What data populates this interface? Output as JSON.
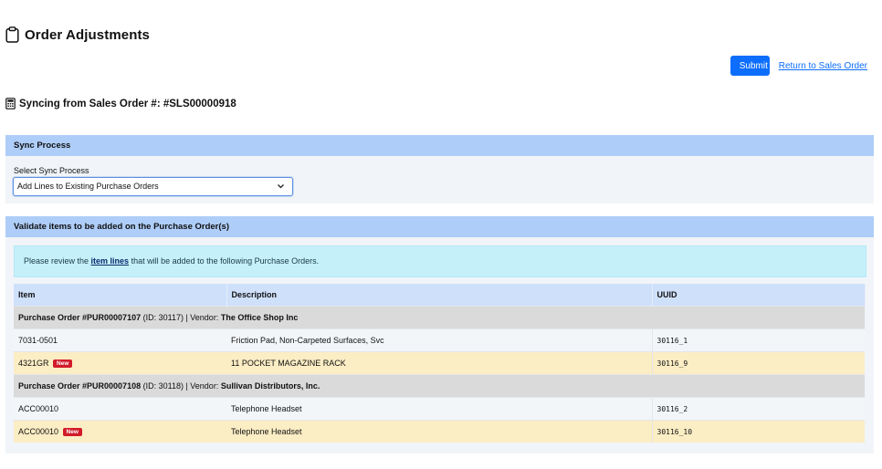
{
  "header": {
    "title": "Order Adjustments",
    "title_icon": "clipboard-icon"
  },
  "actions": {
    "submit_label": "Submit",
    "return_label": "Return to Sales Order"
  },
  "sync_heading": {
    "icon": "calculator-icon",
    "text": "Syncing from Sales Order #: #SLS00000918"
  },
  "sync_panel": {
    "header": "Sync Process",
    "select_label": "Select Sync Process",
    "select_value": "Add Lines to Existing Purchase Orders"
  },
  "validate_panel": {
    "header": "Validate items to be added on the Purchase Order(s)",
    "info_prefix": "Please review the ",
    "info_link": "item lines",
    "info_suffix": " that will be added to the following Purchase Orders."
  },
  "table": {
    "columns": [
      "Item",
      "Description",
      "UUID"
    ],
    "badge_new": "New",
    "groups": [
      {
        "po": "Purchase Order #PUR00007107",
        "id_text": " (ID: 30117) | Vendor: ",
        "vendor": "The Office Shop Inc",
        "rows": [
          {
            "item": "7031-0501",
            "desc": "Friction Pad, Non-Carpeted Surfaces, Svc",
            "uuid": "30116_1",
            "is_new": false
          },
          {
            "item": "4321GR",
            "desc": "11 POCKET MAGAZINE RACK",
            "uuid": "30116_9",
            "is_new": true
          }
        ]
      },
      {
        "po": "Purchase Order #PUR00007108",
        "id_text": " (ID: 30118) | Vendor: ",
        "vendor": "Sullivan Distributors, Inc.",
        "rows": [
          {
            "item": "ACC00010",
            "desc": "Telephone Headset",
            "uuid": "30116_2",
            "is_new": false
          },
          {
            "item": "ACC00010",
            "desc": "Telephone Headset",
            "uuid": "30116_10",
            "is_new": true
          }
        ]
      }
    ]
  },
  "colors": {
    "accent": "#0d6efd",
    "panel_header": "#aecdf8",
    "info_bg": "#c5f0fa",
    "new_row": "#fbedc4",
    "badge": "#d11a2a"
  }
}
